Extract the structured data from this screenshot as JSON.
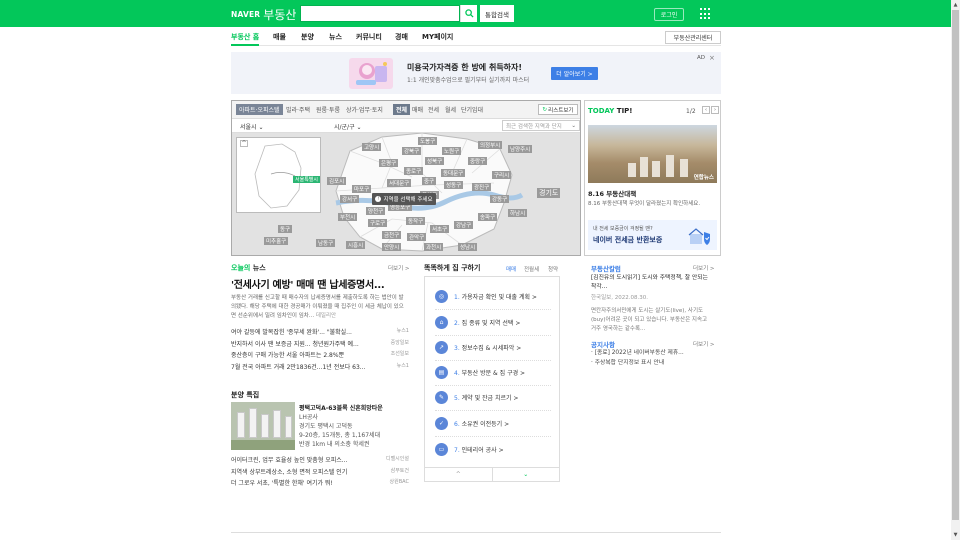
{
  "header": {
    "logo_naver": "NAVER",
    "logo_service": "부동산",
    "search_placeholder": "",
    "total_search": "통합검색",
    "login": "로그인"
  },
  "gnb": {
    "items": [
      "부동산 홈",
      "매물",
      "분양",
      "뉴스",
      "커뮤니티",
      "경매",
      "MY페이지"
    ],
    "manager_center": "부동산관리센터"
  },
  "ad": {
    "title": "미용국가자격증 한 방에 취득하자!",
    "sub": "1:1 개인맞춤수업으로 필기부터 실기까지 마스터",
    "cta": "더 알아보기 >",
    "badge": "AD"
  },
  "map": {
    "property_tabs": [
      "아파트·오피스텔",
      "빌라·주택",
      "원룸·투룸",
      "상가·업무·토지"
    ],
    "trade_tabs": [
      "전체",
      "매매",
      "전세",
      "월세",
      "단기임대"
    ],
    "recent_view": "리스트보기",
    "region_city": "서울시",
    "region_gu": "시/군/구",
    "search_placeholder": "최근 검색한 지역과 단지",
    "minimap_tag": "서울특별시",
    "hint": "지역을 선택해 주세요",
    "gyeonggi": "경기도",
    "districts": {
      "dobong": "도봉구",
      "nowon": "노원구",
      "gangbuk": "강북구",
      "goyang": "고양시",
      "uijeongbu": "의정부시",
      "namyangju": "남양주시",
      "eunpyeong": "은평구",
      "seongbuk": "성북구",
      "jungnang": "중랑구",
      "jongno": "종로구",
      "dongdaemun": "동대문구",
      "guri": "구리시",
      "seodaemun": "서대문구",
      "jung": "중구",
      "mapo": "마포구",
      "seongdong": "성동구",
      "gwangjin": "광진구",
      "gimpo": "김포시",
      "gangseo": "강서구",
      "yongsan": "용산구",
      "gangdong": "강동구",
      "yangcheon": "양천구",
      "yeongdeungpo": "영등포구",
      "dongjak": "동작구",
      "songpa": "송파구",
      "gangnam": "강남구",
      "seocho": "서초구",
      "hanam": "하남시",
      "bucheon": "부천시",
      "guro": "구로구",
      "gwanak": "관악구",
      "geumcheon": "금천구",
      "gwacheon": "과천시",
      "seongnam": "성남시",
      "incheon_dong": "동구",
      "michuhol": "미추홀구",
      "namdong": "남동구",
      "siheung": "시흥시",
      "anyang": "안양시"
    }
  },
  "tip": {
    "title_green": "TODAY",
    "title_dark": " TIP!",
    "page": "1/2",
    "photo_tag": "연합뉴스",
    "headline": "8.16 부동산대책",
    "desc": "8.16 부동산대책 무엇이 달라졌는지 확인하세요.",
    "banner_sub": "내 전세 보증금이 걱정될 땐?",
    "banner_main": "네이버 전세금 반환보증"
  },
  "news": {
    "title_green": "오늘의",
    "title_dark": " 뉴스",
    "more": "더보기 >",
    "headline": "'전세사기 예방' 매매 땐 납세증명서...",
    "body": "부동산 거래를 신고할 때 매수자의 납세증명서를 제출하도록 하는 법안이 발의됐다. 해당 주택에 대한 경공매가 이뤄졌을 때 집주인 이 세금 체납이 있으면 선순위에서 밀려 임차인이 임차...",
    "body_src": "데일리안",
    "items": [
      {
        "t": "여야 갈등에 발목잡힌 '종부세 완화'... \"불확실...",
        "s": "뉴스1"
      },
      {
        "t": "반지하서 이사 땐 보증금 지원... 청년원가주택 예...",
        "s": "중앙일보"
      },
      {
        "t": "중산층이 구매 가능한 서울 아파트는 2.8%뿐",
        "s": "조선일보"
      },
      {
        "t": "7월 전국 아파트 거래 2만1836건...1년 전보다 63...",
        "s": "뉴스1"
      }
    ]
  },
  "project": {
    "title": "분양 특집",
    "name": "평택고덕A-63블록 신혼희망타운",
    "developer": "LH공사",
    "location": "경기도 평택시 고덕동",
    "size": "9-20층, 15개동, 총 1,167세대",
    "note": "반경 1km 내 의소충 학세권",
    "items": [
      {
        "t": "어이터크린, 업무 효율성 높인 맞춤형 오피스...",
        "s": "디벨시인설"
      },
      {
        "t": "지역색 상부트레상소, 소형 면적 오피스텔 인기",
        "s": "삼부토건"
      },
      {
        "t": "더 그로우 서초, '특별한 한채' 여기가 뭐!",
        "s": "상원BAC"
      }
    ]
  },
  "howto": {
    "title": "똑똑하게 집 구하기",
    "tabs": [
      "매매",
      "전월세",
      "청약"
    ],
    "steps": [
      {
        "n": "1.",
        "label": " 가용자금 확인 및 대출 계획 >"
      },
      {
        "n": "2.",
        "label": " 집 종류 및 지역 선택 >"
      },
      {
        "n": "3.",
        "label": " 정보수집 & 시세파악 >"
      },
      {
        "n": "4.",
        "label": " 부동산 방문 & 집 구경 >"
      },
      {
        "n": "5.",
        "label": " 계약 및 잔금 치르기 >"
      },
      {
        "n": "6.",
        "label": " 소유권 이전등기 >"
      },
      {
        "n": "7.",
        "label": " 인테리어 공사 >"
      }
    ],
    "nav_up": "^",
    "nav_down": "⌄"
  },
  "realty_learn": {
    "title": "부동산칼럼",
    "more": "더보기 >",
    "headline_1": "[김진유의 도시읽기] 도시와 주택정책, 잘 안되는",
    "headline_2": "착각...",
    "source": "한국일보, 2022.08.30.",
    "body_1": "면칸자주의서민에게 도시는 살기도(live), 사기도",
    "body_2": "(buy)어려운 곳이 되고 있습니다. 부동산은 지속고",
    "body_3": "거주 영국하는 같수록..."
  },
  "notice": {
    "title": "공지사항",
    "more": "더보기 >",
    "items": [
      "[종료] 2022년 네이버부동산 제휴...",
      "주상복합 단지정보 표시 안내"
    ]
  }
}
